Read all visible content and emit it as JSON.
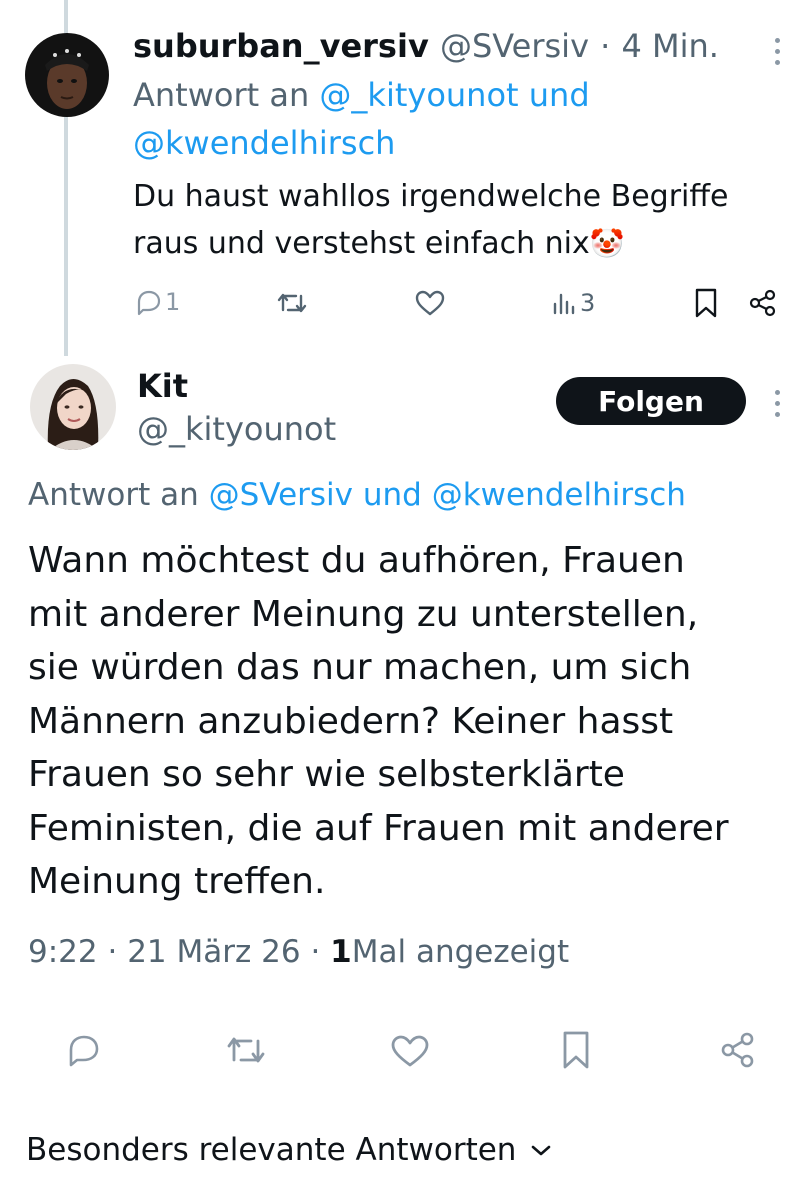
{
  "reply": {
    "display_name": "suburban_versiv",
    "handle": "@SVersiv",
    "separator": "·",
    "time": "4 Min.",
    "reply_prefix": "Antwort an",
    "reply_to_line1": "@_kityounot und",
    "reply_to_line2": "@kwendelhirsch",
    "text_line1": "Du haust wahllos irgendwelche Begriffe",
    "text_line2": "raus und verstehst einfach nix",
    "emoji": "🤡",
    "reply_count": "1",
    "views_count": "3",
    "icons": [
      "reply-icon",
      "retweet-icon",
      "like-icon",
      "views-icon",
      "bookmark-icon",
      "share-icon",
      "more-icon"
    ]
  },
  "main_post": {
    "display_name": "Kit",
    "handle": "@_kityounot",
    "follow_label": "Folgen",
    "reply_prefix": "Antwort an",
    "reply_to_1": "@SVersiv",
    "reply_to_and": "und",
    "reply_to_2": "@kwendelhirsch",
    "text_lines": [
      "Wann möchtest du aufhören, Frauen",
      "mit anderer Meinung zu unterstellen,",
      "sie würden das nur machen, um sich",
      "Männern anzubiedern? Keiner hasst",
      "Frauen so sehr wie selbsterklärte",
      "Feministen, die auf Frauen mit anderer",
      "Meinung treffen."
    ],
    "time": "9:22",
    "sep1": "·",
    "date": "21 März 26",
    "sep2": "·",
    "views_number": "1",
    "views_label": "Mal angezeigt",
    "icons": [
      "reply-icon",
      "retweet-icon",
      "like-icon",
      "bookmark-icon",
      "share-icon"
    ]
  },
  "sort": {
    "label": "Besonders relevante Antworten",
    "icon": "chevron-down-icon"
  },
  "colors": {
    "text": "#0f1419",
    "secondary": "#536471",
    "link": "#1d9bf0",
    "icon": "#8b98a5",
    "thread_line": "#cfd9de",
    "button_bg": "#0f1419"
  }
}
